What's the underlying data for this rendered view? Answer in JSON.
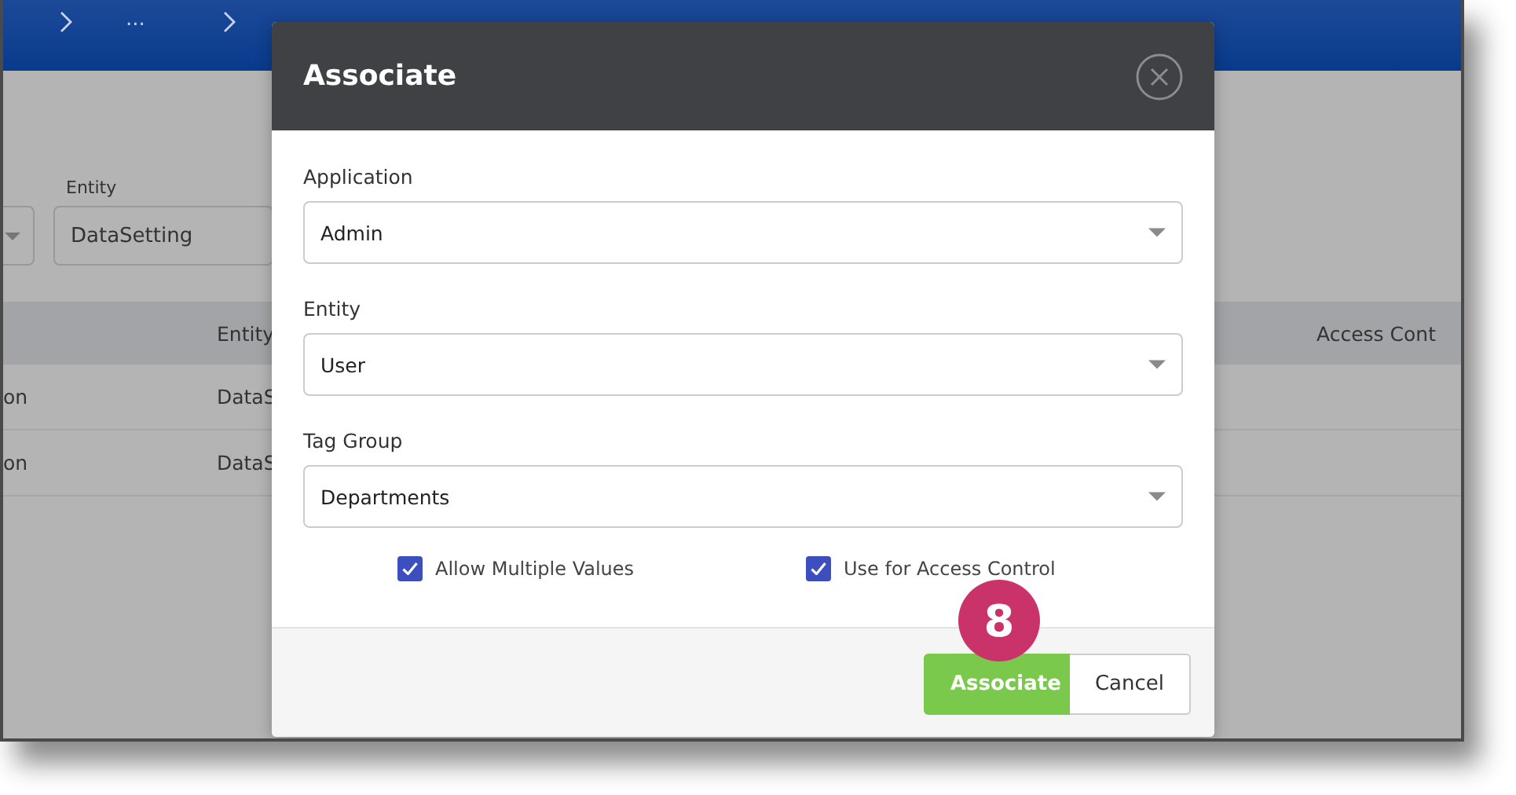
{
  "breadcrumbs": [
    "..."
  ],
  "filters": [
    {
      "label": "Entity",
      "value": "DataSetting"
    }
  ],
  "table": {
    "columns": [
      "",
      "Entity",
      "Access Cont"
    ],
    "rows": [
      [
        "on",
        "DataS"
      ],
      [
        "on",
        "DataS"
      ]
    ]
  },
  "dialog": {
    "title": "Associate",
    "fields": [
      {
        "label": "Application",
        "value": "Admin"
      },
      {
        "label": "Entity",
        "value": "User"
      },
      {
        "label": "Tag Group",
        "value": "Departments"
      }
    ],
    "options": [
      {
        "label": "Allow Multiple Values",
        "checked": true
      },
      {
        "label": "Use for Access Control",
        "checked": true
      }
    ],
    "buttons": [
      {
        "label": "Associate",
        "kind": "primary"
      },
      {
        "label": "Cancel",
        "kind": "secondary"
      }
    ],
    "step_badge": "8"
  }
}
